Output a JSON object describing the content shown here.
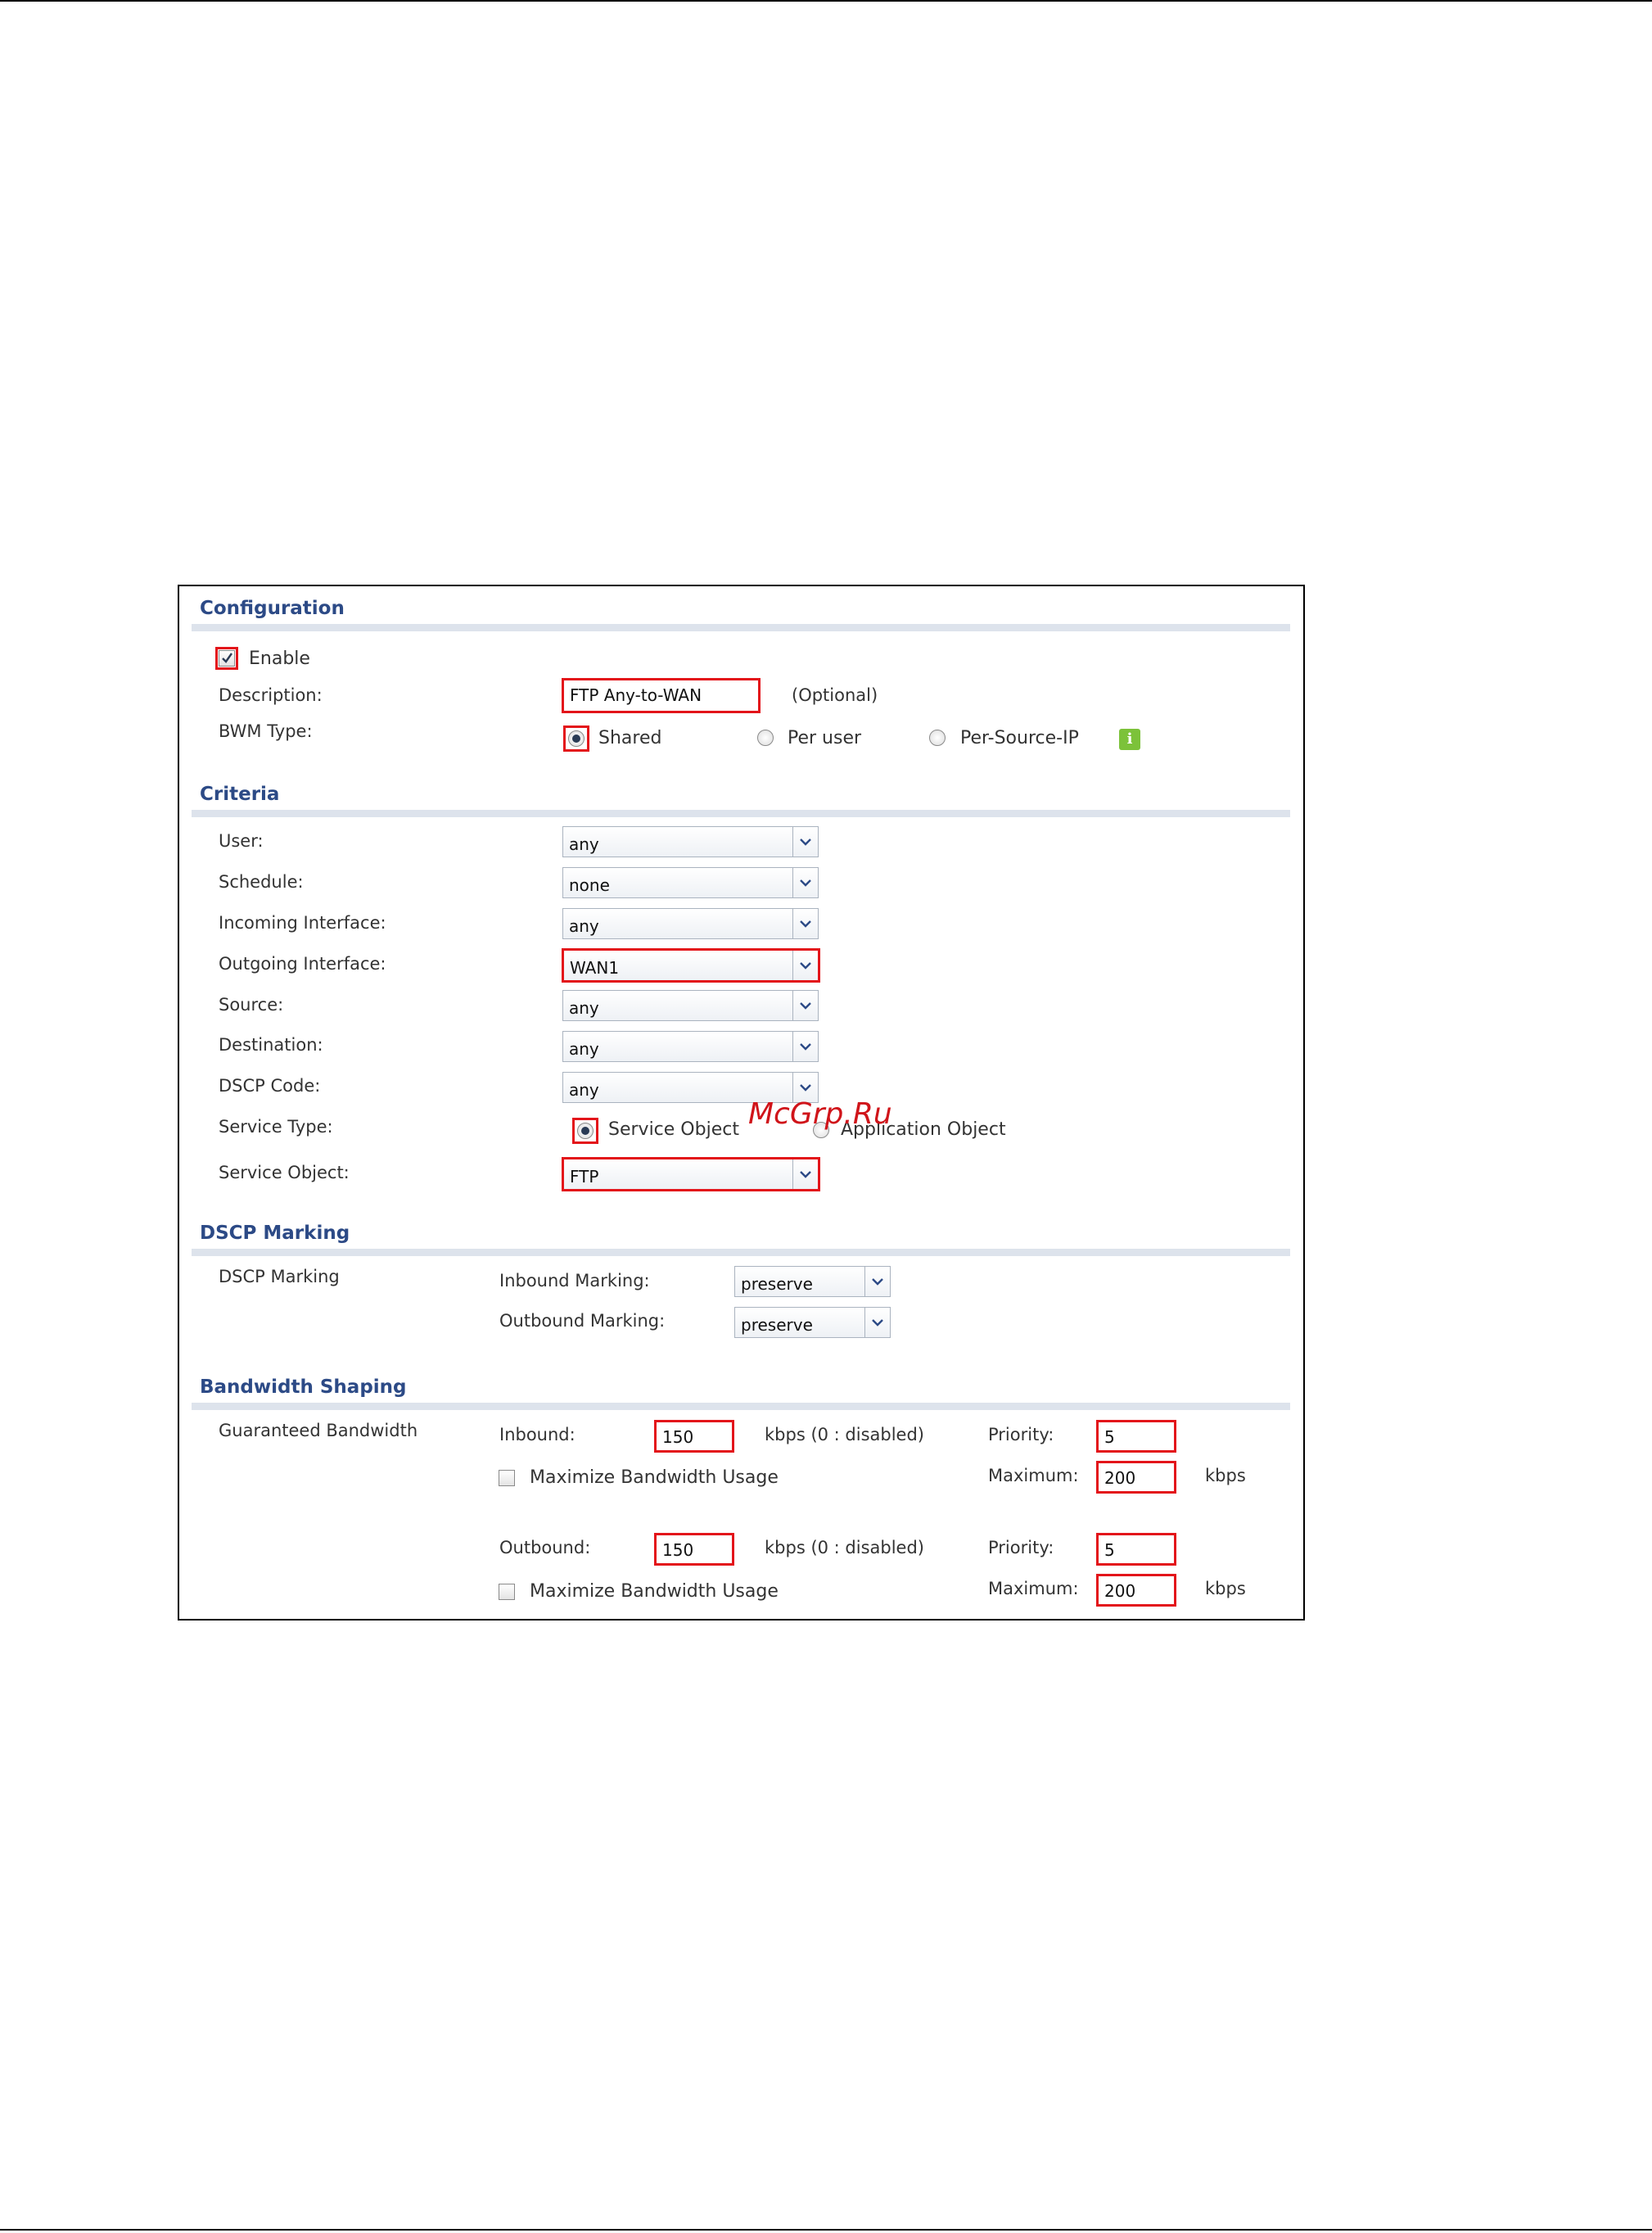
{
  "configuration": {
    "title": "Configuration",
    "enable_label": "Enable",
    "description_label": "Description:",
    "description_value": "FTP Any-to-WAN",
    "description_hint": "(Optional)",
    "bwm_type_label": "BWM Type:",
    "bwm_options": [
      "Shared",
      "Per user",
      "Per-Source-IP"
    ],
    "bwm_selected": "Shared",
    "info_glyph": "i"
  },
  "criteria": {
    "title": "Criteria",
    "user_label": "User:",
    "user_value": "any",
    "schedule_label": "Schedule:",
    "schedule_value": "none",
    "incoming_label": "Incoming Interface:",
    "incoming_value": "any",
    "outgoing_label": "Outgoing Interface:",
    "outgoing_value": "WAN1",
    "source_label": "Source:",
    "source_value": "any",
    "destination_label": "Destination:",
    "destination_value": "any",
    "dscp_code_label": "DSCP Code:",
    "dscp_code_value": "any",
    "service_type_label": "Service Type:",
    "service_type_options": [
      "Service Object",
      "Application Object"
    ],
    "service_type_selected": "Service Object",
    "service_object_label": "Service Object:",
    "service_object_value": "FTP"
  },
  "dscp_marking": {
    "title": "DSCP Marking",
    "row_label": "DSCP Marking",
    "inbound_label": "Inbound Marking:",
    "inbound_value": "preserve",
    "outbound_label": "Outbound Marking:",
    "outbound_value": "preserve"
  },
  "bandwidth_shaping": {
    "title": "Bandwidth Shaping",
    "row_label": "Guaranteed Bandwidth",
    "inbound_label": "Inbound:",
    "inbound_value": "150",
    "inbound_unit": "kbps (0 : disabled)",
    "inbound_priority_label": "Priority:",
    "inbound_priority_value": "5",
    "inbound_max_usage_label": "Maximize Bandwidth Usage",
    "inbound_maximum_label": "Maximum:",
    "inbound_maximum_value": "200",
    "inbound_maximum_unit": "kbps",
    "outbound_label": "Outbound:",
    "outbound_value": "150",
    "outbound_unit": "kbps (0 : disabled)",
    "outbound_priority_label": "Priority:",
    "outbound_priority_value": "5",
    "outbound_max_usage_label": "Maximize Bandwidth Usage",
    "outbound_maximum_label": "Maximum:",
    "outbound_maximum_value": "200",
    "outbound_maximum_unit": "kbps"
  },
  "watermark": "McGrp.Ru",
  "colors": {
    "highlight": "#e3141a",
    "section_title": "#2c4a86",
    "section_bar": "#dde3ec"
  },
  "icons": [
    "checkbox-icon",
    "radio-icon",
    "chevron-down-icon",
    "info-icon"
  ]
}
